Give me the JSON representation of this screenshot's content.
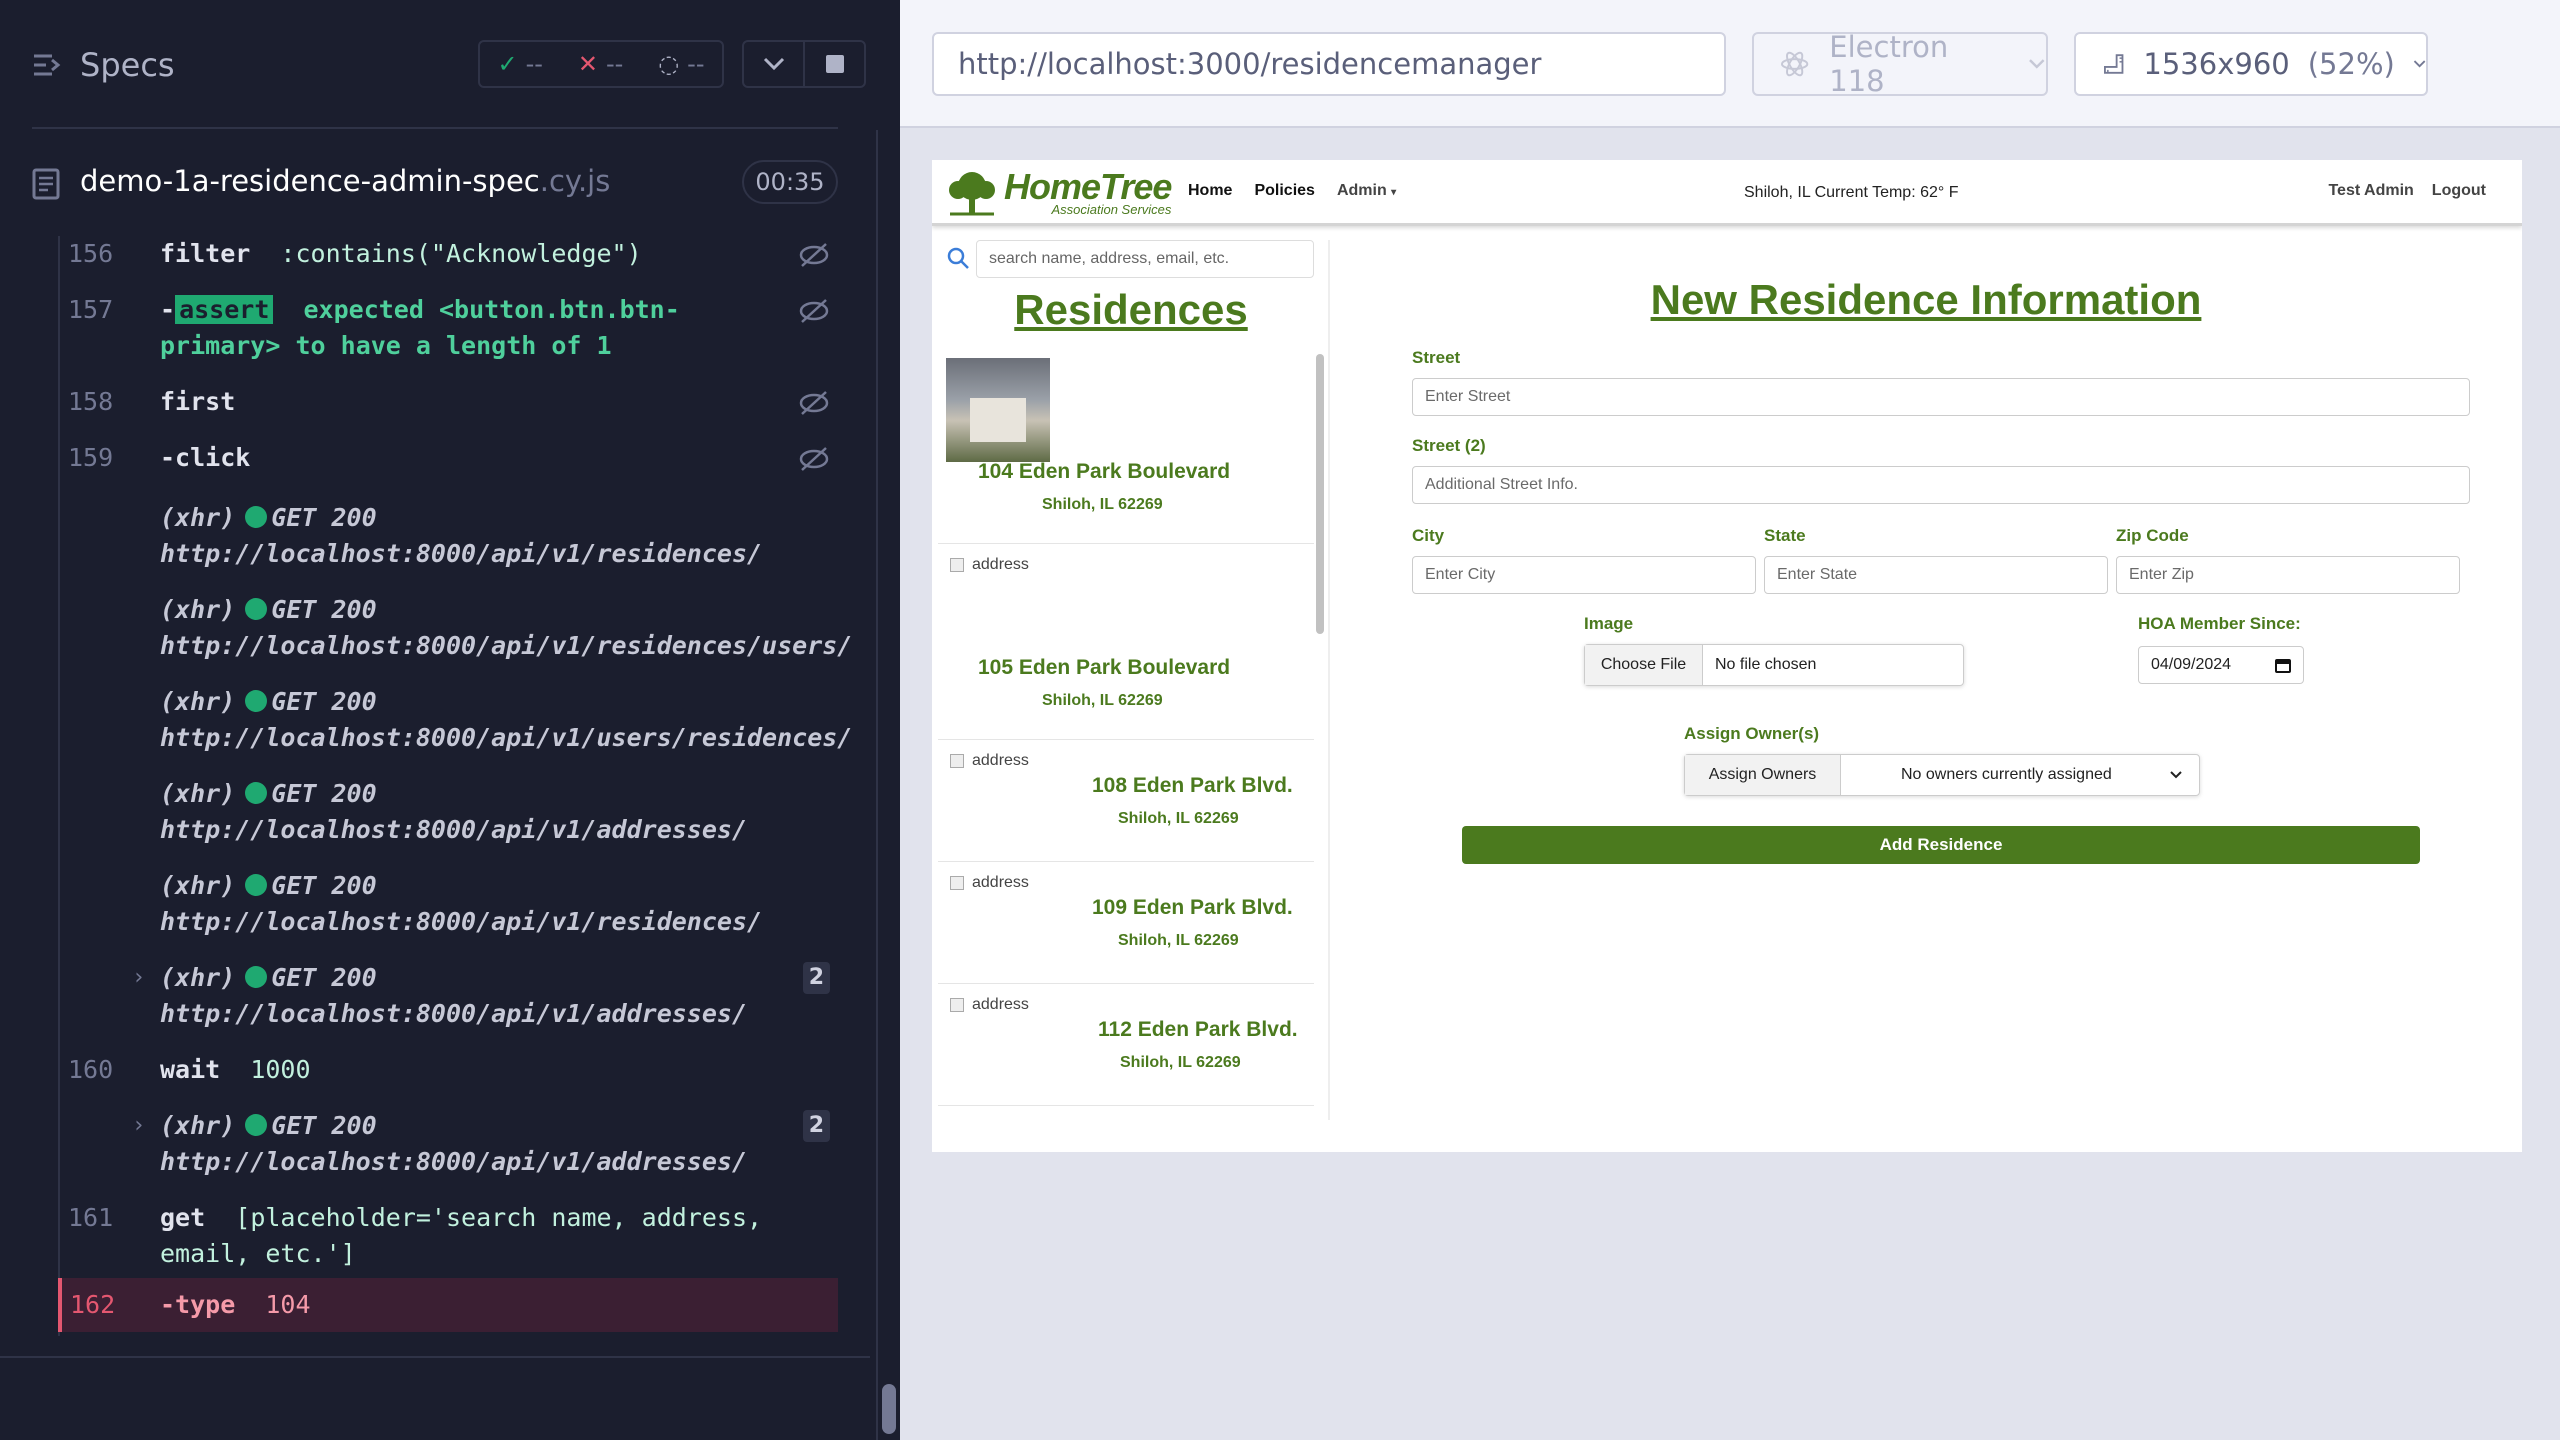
{
  "reporter": {
    "specs_label": "Specs",
    "stats": {
      "passed": "--",
      "failed": "--",
      "pending": "--"
    },
    "spec": {
      "name": "demo-1a-residence-admin-spec",
      "ext": ".cy.js",
      "duration": "00:35"
    },
    "commands": [
      {
        "num": "156",
        "name": "filter",
        "arg": ":contains(\"Acknowledge\")"
      },
      {
        "num": "157",
        "name": "-assert",
        "arg_pre": "expected",
        "arg_code": "<button.btn.btn-primary>",
        "arg_post": "to have a length of",
        "arg_val": "1"
      },
      {
        "num": "158",
        "name": "first",
        "arg": ""
      },
      {
        "num": "159",
        "name": "-click",
        "arg": ""
      },
      {
        "xhr": "(xhr)",
        "method": "GET 200",
        "url": "http://localhost:8000/api/v1/residences/"
      },
      {
        "xhr": "(xhr)",
        "method": "GET 200",
        "url": "http://localhost:8000/api/v1/residences/users/"
      },
      {
        "xhr": "(xhr)",
        "method": "GET 200",
        "url": "http://localhost:8000/api/v1/users/residences/"
      },
      {
        "xhr": "(xhr)",
        "method": "GET 200",
        "url": "http://localhost:8000/api/v1/addresses/"
      },
      {
        "xhr": "(xhr)",
        "method": "GET 200",
        "url": "http://localhost:8000/api/v1/residences/"
      },
      {
        "xhr": "(xhr)",
        "method": "GET 200",
        "url": "http://localhost:8000/api/v1/addresses/",
        "count": "2"
      },
      {
        "num": "160",
        "name": "wait",
        "arg": "1000"
      },
      {
        "xhr": "(xhr)",
        "method": "GET 200",
        "url": "http://localhost:8000/api/v1/addresses/",
        "count": "2"
      },
      {
        "num": "161",
        "name": "get",
        "arg": "[placeholder='search name, address, email, etc.']"
      },
      {
        "num": "162",
        "name": "-type",
        "arg": "104"
      }
    ]
  },
  "runner": {
    "url": "http://localhost:3000/residencemanager",
    "browser": "Electron 118",
    "viewport": "1536x960",
    "viewport_pct": "(52%)"
  },
  "app": {
    "logo_main": "HomeTree",
    "logo_sub": "Association Services",
    "nav": {
      "home": "Home",
      "policies": "Policies",
      "admin": "Admin"
    },
    "temp": "Shiloh, IL Current Temp: 62° F",
    "user": "Test Admin",
    "logout": "Logout",
    "search_placeholder": "search name, address, email, etc.",
    "residences_title": "Residences",
    "residences": [
      {
        "address": "104 Eden Park Boulevard",
        "city": "Shiloh, IL 62269",
        "image": "photo"
      },
      {
        "address": "105 Eden Park Boulevard",
        "city": "Shiloh, IL 62269",
        "image_alt": "address"
      },
      {
        "address": "108 Eden Park Blvd.",
        "city": "Shiloh, IL 62269",
        "image_alt": "address"
      },
      {
        "address": "109 Eden Park Blvd.",
        "city": "Shiloh, IL 62269",
        "image_alt": "address"
      },
      {
        "address": "112 Eden Park Blvd.",
        "city": "Shiloh, IL 62269",
        "image_alt": "address"
      }
    ],
    "form": {
      "title": "New Residence Information",
      "street_label": "Street",
      "street_placeholder": "Enter Street",
      "street2_label": "Street (2)",
      "street2_placeholder": "Additional Street Info.",
      "city_label": "City",
      "city_placeholder": "Enter City",
      "state_label": "State",
      "state_placeholder": "Enter State",
      "zip_label": "Zip Code",
      "zip_placeholder": "Enter Zip",
      "image_label": "Image",
      "choose_file": "Choose File",
      "no_file": "No file chosen",
      "hoa_label": "HOA Member Since:",
      "hoa_value": "04/09/2024",
      "owners_label": "Assign Owner(s)",
      "owners_button": "Assign Owners",
      "owners_value": "No owners currently assigned",
      "submit": "Add Residence"
    }
  }
}
